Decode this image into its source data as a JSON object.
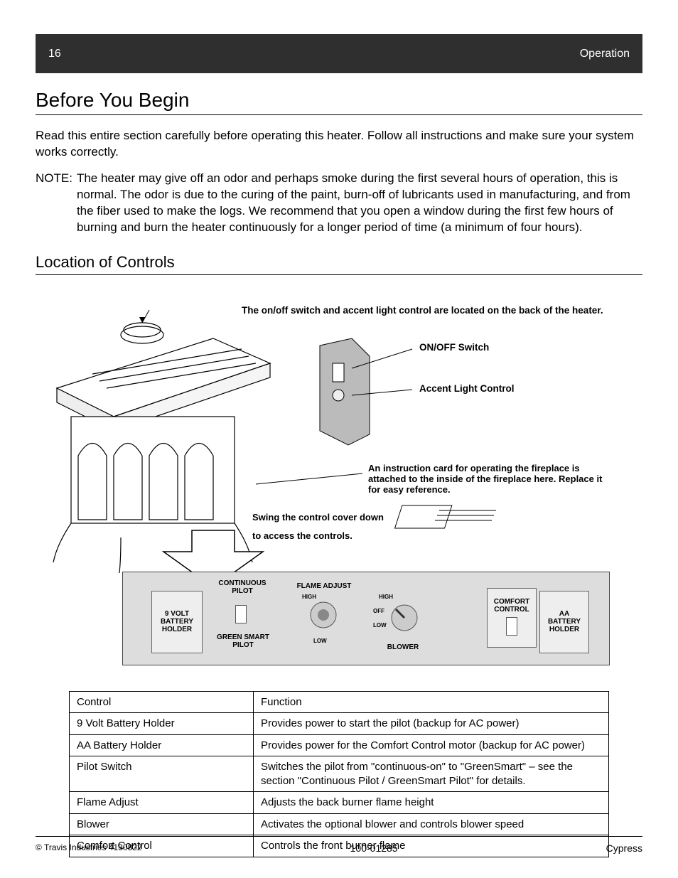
{
  "banner": {
    "left": "16",
    "right": "Operation"
  },
  "section": {
    "title": "Before You Begin"
  },
  "intro": "Read this entire section carefully before operating this heater. Follow all instructions and make sure your system works correctly.",
  "note": {
    "label": "NOTE:",
    "body": "The heater may give off an odor and perhaps smoke during the first several hours of operation, this is normal. The odor is due to the curing of the paint, burn-off of lubricants used in manufacturing, and from the fiber used to make the logs. We recommend that you open a window during the first few hours of burning and burn the heater continuously for a longer period of time (a minimum of four hours)."
  },
  "sub_title": "Location of Controls",
  "diagram": {
    "top_line": "The on/off switch and accent light control are located on the back of the heater.",
    "onoff": "ON/OFF Switch",
    "accent": "Accent Light Control",
    "instr": "An instruction card for operating the fireplace is attached to the inside of the fireplace here. Replace it for easy reference.",
    "swing1": "Swing the control cover down",
    "swing2": "to access the controls.",
    "panel": {
      "ninevolt": "9 VOLT\nBATTERY\nHOLDER",
      "cont": "CONTINUOUS\nPILOT",
      "green": "GREEN SMART\nPILOT",
      "flame": "FLAME ADJUST",
      "flame_high": "HIGH",
      "flame_low": "LOW",
      "blower": "BLOWER",
      "blow_high": "HIGH",
      "blow_off": "OFF",
      "blow_low": "LOW",
      "comfort": "COMFORT\nCONTROL",
      "aa": "AA\nBATTERY\nHOLDER"
    }
  },
  "table": [
    {
      "c": "Control",
      "d": "Function"
    },
    {
      "c": "9 Volt Battery Holder",
      "d": "Provides power to start the pilot (backup for AC power)"
    },
    {
      "c": "AA Battery Holder",
      "d": "Provides power for the Comfort Control motor (backup for AC power)"
    },
    {
      "c": "Pilot Switch",
      "d": "Switches the pilot from \"continuous-on\" to \"GreenSmart\" – see the section \"Continuous Pilot / GreenSmart Pilot\" for details."
    },
    {
      "c": "Flame Adjust",
      "d": "Adjusts the back burner flame height"
    },
    {
      "c": "Blower",
      "d": "Activates the optional blower and controls blower speed"
    },
    {
      "c": "Comfort Control",
      "d": "Controls the front burner flame"
    }
  ],
  "footer": {
    "copy": "© Travis Industries 4130822",
    "code": "100-01285",
    "model": "Cypress"
  }
}
